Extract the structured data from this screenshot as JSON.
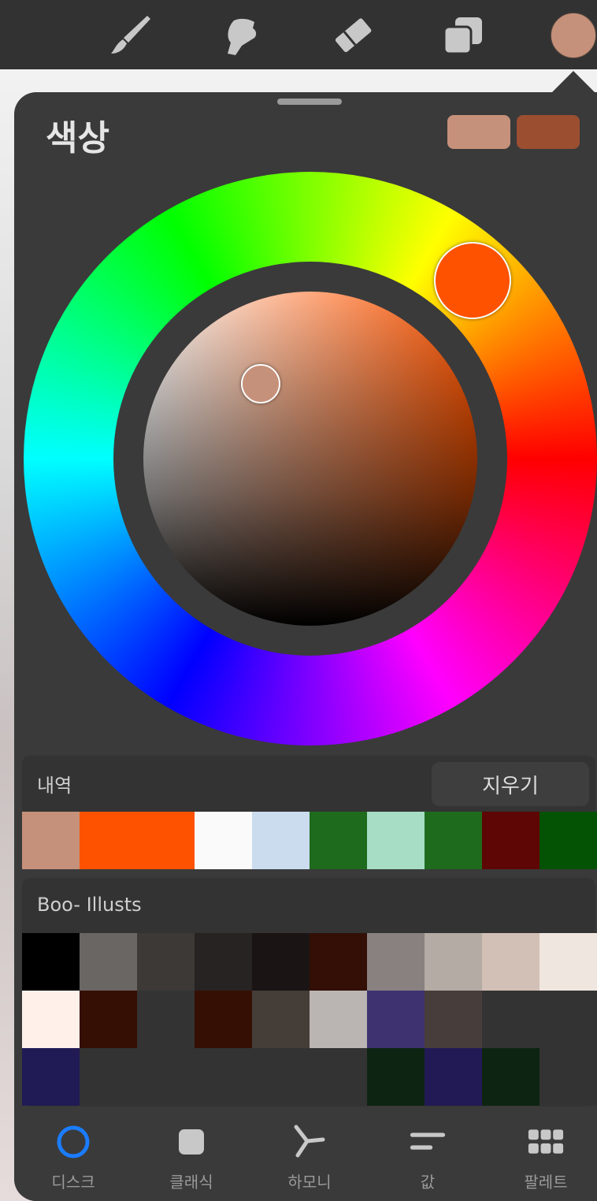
{
  "panel": {
    "title": "색상",
    "primary_color": "#c6917a",
    "secondary_color": "#9c4e31",
    "selected_hue_color": "#ff5200",
    "selected_color": "#c6917a"
  },
  "history": {
    "label": "내역",
    "clear_label": "지우기",
    "colors": [
      "#c6917a",
      "#ff5200",
      "#ff5200",
      "#fafafa",
      "#ccdcef",
      "#1e6b1e",
      "#a6ddc4",
      "#1e6b1e",
      "#5e0505",
      "#045204"
    ]
  },
  "palette": {
    "name": "Boo- Illusts",
    "colors": [
      "#000000",
      "#696664",
      "#3c3936",
      "#272322",
      "#1a1514",
      "#330f06",
      "#888180",
      "#b3aba4",
      "#d2bfb5",
      "#f0e6e0",
      "#fff0ea",
      "#350f04",
      "#333333",
      "#350f04",
      "#453d38",
      "#bab4b2",
      "#3e3370",
      "#473e3b",
      "#333333",
      "#333333",
      "#201a55",
      "#333333",
      "#333333",
      "#333333",
      "#333333",
      "#333333",
      "#0e2412",
      "#221a55",
      "#0e2412",
      "#333333"
    ]
  },
  "tabs": [
    {
      "label": "디스크",
      "icon": "disc-icon",
      "active": true
    },
    {
      "label": "클래식",
      "icon": "classic-square-icon",
      "active": false
    },
    {
      "label": "하모니",
      "icon": "harmony-icon",
      "active": false
    },
    {
      "label": "값",
      "icon": "value-sliders-icon",
      "active": false
    },
    {
      "label": "팔레트",
      "icon": "palette-grid-icon",
      "active": false
    }
  ],
  "toolbar": {
    "tools": [
      "brush-icon",
      "smudge-icon",
      "eraser-icon",
      "layers-icon"
    ],
    "current_color": "#c6917a"
  },
  "colors": {
    "accent": "#1a7cff",
    "panel_bg": "#3a3a3a",
    "toolbar_bg": "#323232"
  }
}
